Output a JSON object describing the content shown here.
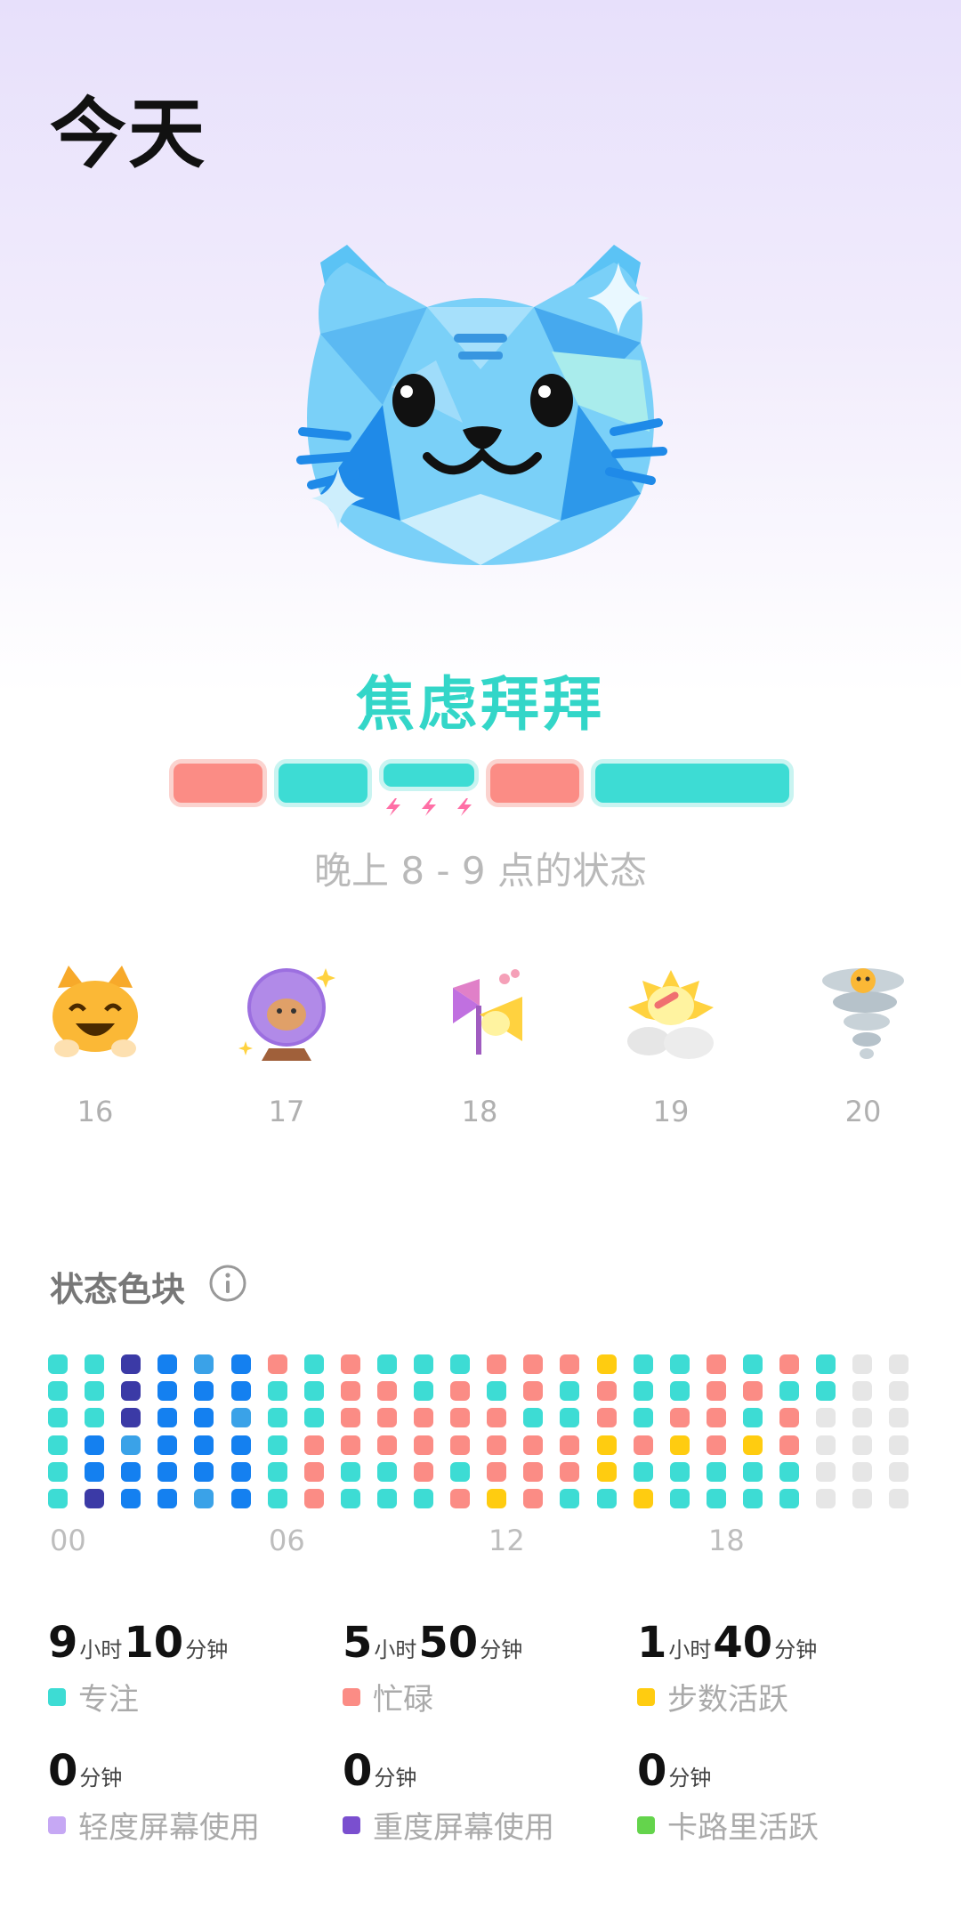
{
  "header": {
    "title": "今天"
  },
  "mood": {
    "title": "焦虑拜拜",
    "caption": "晚上 8 - 9 点的状态",
    "segments": [
      "busy",
      "focus",
      "focus",
      "busy",
      "focus"
    ]
  },
  "days": [
    {
      "label": "16",
      "icon": "grinning-cat-icon"
    },
    {
      "label": "17",
      "icon": "crystal-ball-cat-icon"
    },
    {
      "label": "18",
      "icon": "pinwheel-horn-icon"
    },
    {
      "label": "19",
      "icon": "sun-cloud-icon"
    },
    {
      "label": "20",
      "icon": "tornado-cat-icon"
    }
  ],
  "status_section": {
    "title": "状态色块",
    "info_icon": "info-icon",
    "time_ticks": [
      "00",
      "06",
      "12",
      "18"
    ],
    "colors": {
      "focus": "#3ddcd4",
      "busy": "#fb8c85",
      "steps": "#ffcc10",
      "light": "#c6a8f4",
      "heavy": "#7a4fcf",
      "calorie": "#64d44c",
      "sleep_dark": "#3b3aa6",
      "sleep_blue": "#1480f0",
      "sleep_light": "#3aa2e8",
      "empty": "#e6e6e6"
    },
    "grid": [
      [
        "f",
        "f",
        "f",
        "f",
        "f",
        "f"
      ],
      [
        "f",
        "f",
        "f",
        "sb",
        "sb",
        "d"
      ],
      [
        "d",
        "d",
        "d",
        "sl",
        "sb",
        "sb"
      ],
      [
        "sb",
        "sb",
        "sb",
        "sb",
        "sb",
        "sb"
      ],
      [
        "sl",
        "sb",
        "sb",
        "sb",
        "sb",
        "sl"
      ],
      [
        "sb",
        "sb",
        "sl",
        "sb",
        "sb",
        "sb"
      ],
      [
        "b",
        "f",
        "f",
        "f",
        "f",
        "f"
      ],
      [
        "f",
        "f",
        "f",
        "b",
        "b",
        "b"
      ],
      [
        "b",
        "b",
        "b",
        "b",
        "f",
        "f"
      ],
      [
        "f",
        "b",
        "b",
        "b",
        "f",
        "f"
      ],
      [
        "f",
        "f",
        "b",
        "b",
        "b",
        "f"
      ],
      [
        "f",
        "b",
        "b",
        "b",
        "f",
        "b"
      ],
      [
        "b",
        "f",
        "b",
        "b",
        "b",
        "y"
      ],
      [
        "b",
        "b",
        "f",
        "b",
        "b",
        "b"
      ],
      [
        "b",
        "f",
        "f",
        "b",
        "b",
        "f"
      ],
      [
        "y",
        "b",
        "b",
        "y",
        "y",
        "f"
      ],
      [
        "f",
        "f",
        "f",
        "b",
        "f",
        "y"
      ],
      [
        "f",
        "f",
        "b",
        "y",
        "f",
        "f"
      ],
      [
        "b",
        "b",
        "b",
        "b",
        "f",
        "f"
      ],
      [
        "f",
        "b",
        "f",
        "y",
        "f",
        "f"
      ],
      [
        "b",
        "f",
        "b",
        "b",
        "f",
        "f"
      ],
      [
        "f",
        "f",
        "e",
        "e",
        "e",
        "e"
      ],
      [
        "e",
        "e",
        "e",
        "e",
        "e",
        "e"
      ],
      [
        "e",
        "e",
        "e",
        "e",
        "e",
        "e"
      ]
    ]
  },
  "stats": [
    {
      "h": "9",
      "h_unit": "小时",
      "m": "10",
      "m_unit": "分钟",
      "label": "专注",
      "color": "#3ddcd4"
    },
    {
      "h": "5",
      "h_unit": "小时",
      "m": "50",
      "m_unit": "分钟",
      "label": "忙碌",
      "color": "#fb8c85"
    },
    {
      "h": "1",
      "h_unit": "小时",
      "m": "40",
      "m_unit": "分钟",
      "label": "步数活跃",
      "color": "#ffcc10"
    },
    {
      "m": "0",
      "m_unit": "分钟",
      "label": "轻度屏幕使用",
      "color": "#c6a8f4"
    },
    {
      "m": "0",
      "m_unit": "分钟",
      "label": "重度屏幕使用",
      "color": "#7a4fcf"
    },
    {
      "m": "0",
      "m_unit": "分钟",
      "label": "卡路里活跃",
      "color": "#64d44c"
    }
  ]
}
